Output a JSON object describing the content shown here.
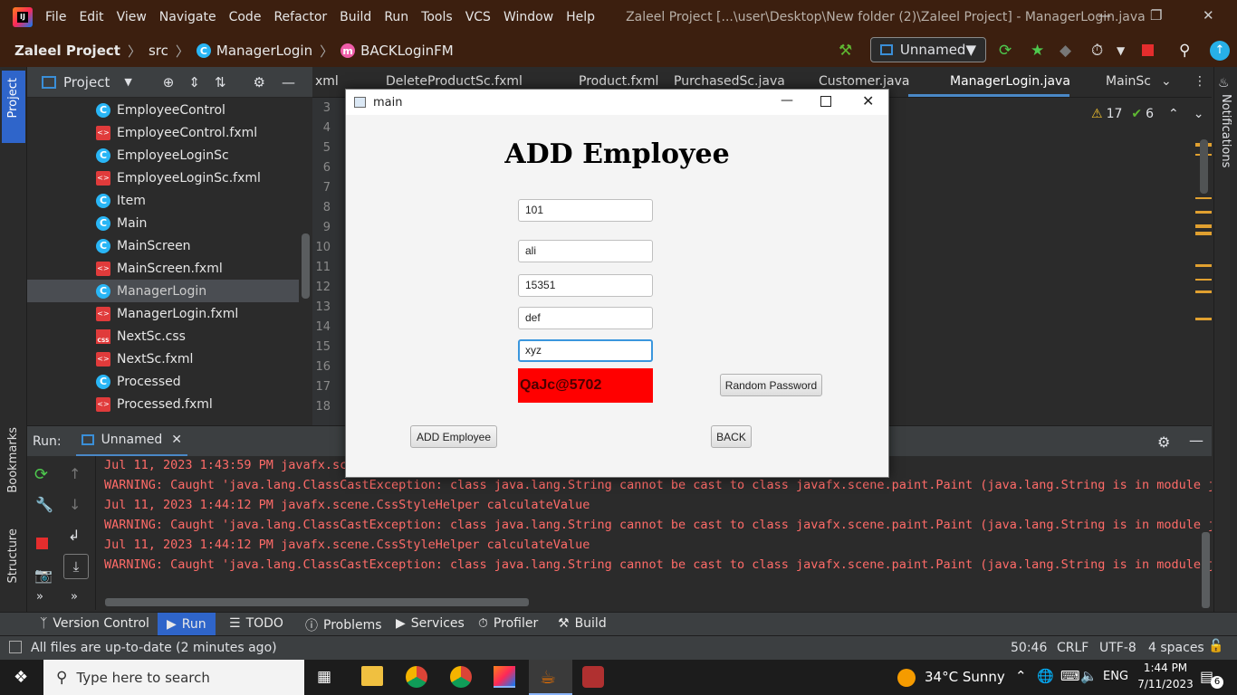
{
  "menu": {
    "items": [
      "File",
      "Edit",
      "View",
      "Navigate",
      "Code",
      "Refactor",
      "Build",
      "Run",
      "Tools",
      "VCS",
      "Window",
      "Help"
    ],
    "window_title": "Zaleel Project [...\\user\\Desktop\\New folder (2)\\Zaleel Project] - ManagerLogin.java"
  },
  "breadcrumb": {
    "project": "Zaleel Project",
    "src": "src",
    "class": "ManagerLogin",
    "method": "BACKLoginFM"
  },
  "run_config": "Unnamed",
  "project_panel": {
    "title": "Project",
    "items": [
      {
        "label": "EmployeeControl",
        "kind": "class"
      },
      {
        "label": "EmployeeControl.fxml",
        "kind": "fxml"
      },
      {
        "label": "EmployeeLoginSc",
        "kind": "class"
      },
      {
        "label": "EmployeeLoginSc.fxml",
        "kind": "fxml"
      },
      {
        "label": "Item",
        "kind": "class"
      },
      {
        "label": "Main",
        "kind": "class"
      },
      {
        "label": "MainScreen",
        "kind": "class"
      },
      {
        "label": "MainScreen.fxml",
        "kind": "fxml"
      },
      {
        "label": "ManagerLogin",
        "kind": "class"
      },
      {
        "label": "ManagerLogin.fxml",
        "kind": "fxml"
      },
      {
        "label": "NextSc.css",
        "kind": "css"
      },
      {
        "label": "NextSc.fxml",
        "kind": "fxml"
      },
      {
        "label": "Processed",
        "kind": "class"
      },
      {
        "label": "Processed.fxml",
        "kind": "fxml"
      }
    ]
  },
  "editor_tabs": [
    "xml",
    "DeleteProductSc.fxml",
    "Product.fxml",
    "PurchasedSc.java",
    "Customer.java",
    "ManagerLogin.java",
    "MainSc"
  ],
  "line_numbers": [
    "3",
    "4",
    "5",
    "6",
    "7",
    "8",
    "9",
    "10",
    "11",
    "12",
    "13",
    "14",
    "15",
    "16",
    "17",
    "18"
  ],
  "inspections": {
    "warnings": "17",
    "ok": "6"
  },
  "dialog": {
    "title": "main",
    "heading": "ADD Employee",
    "fields": [
      "101",
      "ali",
      "15351",
      "def",
      "xyz"
    ],
    "password": "QaJc@5702",
    "random_password_label": "Random Password",
    "add_label": "ADD Employee",
    "back_label": "BACK"
  },
  "run_panel": {
    "label": "Run:",
    "tab": "Unnamed",
    "lines": [
      {
        "type": "t",
        "text": "Jul 11, 2023 1:43:59 PM javafx.scene.CssStyleHelper calculateValue"
      },
      {
        "type": "w",
        "text": "WARNING: Caught 'java.lang.ClassCastException: class java.lang.String cannot be cast to class javafx.scene.paint.Paint (java.lang.String is in module java"
      },
      {
        "type": "t",
        "text": "Jul 11, 2023 1:44:12 PM javafx.scene.CssStyleHelper calculateValue"
      },
      {
        "type": "w",
        "text": "WARNING: Caught 'java.lang.ClassCastException: class java.lang.String cannot be cast to class javafx.scene.paint.Paint (java.lang.String is in module java"
      },
      {
        "type": "t",
        "text": "Jul 11, 2023 1:44:12 PM javafx.scene.CssStyleHelper calculateValue"
      },
      {
        "type": "w",
        "text": "WARNING: Caught 'java.lang.ClassCastException: class java.lang.String cannot be cast to class javafx.scene.paint.Paint (java.lang.String is in module java"
      }
    ]
  },
  "tool_tabs": [
    "Version Control",
    "Run",
    "TODO",
    "Problems",
    "Services",
    "Profiler",
    "Build"
  ],
  "side_tabs": {
    "project": "Project",
    "bookmarks": "Bookmarks",
    "structure": "Structure",
    "notifications": "Notifications"
  },
  "status": {
    "message": "All files are up-to-date (2 minutes ago)",
    "position": "50:46",
    "line_sep": "CRLF",
    "encoding": "UTF-8",
    "indent": "4 spaces"
  },
  "taskbar": {
    "search_placeholder": "Type here to search",
    "weather": "34°C  Sunny",
    "lang": "ENG",
    "time": "1:44 PM",
    "date": "7/11/2023",
    "notif_count": "6"
  },
  "colors": {
    "accent": "#2f65ca",
    "password_bg": "#ff0000",
    "warning_text": "#ff6b68",
    "titlebar": "#3c1f0f"
  }
}
